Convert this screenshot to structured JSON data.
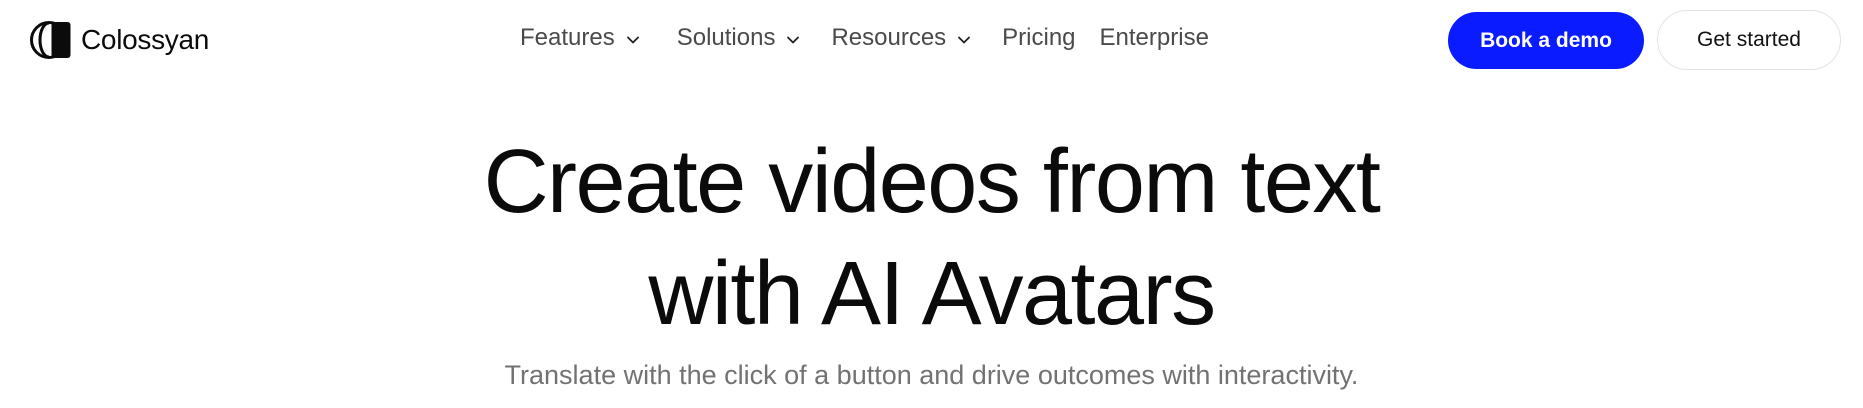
{
  "brand": {
    "name": "Colossyan",
    "logo_icon": "colossyan-logo-icon"
  },
  "nav": {
    "items": [
      {
        "label": "Features",
        "has_dropdown": true
      },
      {
        "label": "Solutions",
        "has_dropdown": true
      },
      {
        "label": "Resources",
        "has_dropdown": true
      },
      {
        "label": "Pricing",
        "has_dropdown": false
      },
      {
        "label": "Enterprise",
        "has_dropdown": false
      }
    ],
    "dropdown_icon": "chevron-down-icon"
  },
  "cta": {
    "book_demo_label": "Book a demo",
    "get_started_label": "Get started"
  },
  "hero": {
    "title_line1": "Create videos from text",
    "title_line2": "with AI Avatars",
    "subtitle": "Translate with the click of a button and drive outcomes with interactivity."
  },
  "colors": {
    "primary_button": "#0a1cff",
    "nav_text": "#4a4a4a",
    "subtitle_text": "#727272",
    "heading_text": "#0b0b0b"
  }
}
